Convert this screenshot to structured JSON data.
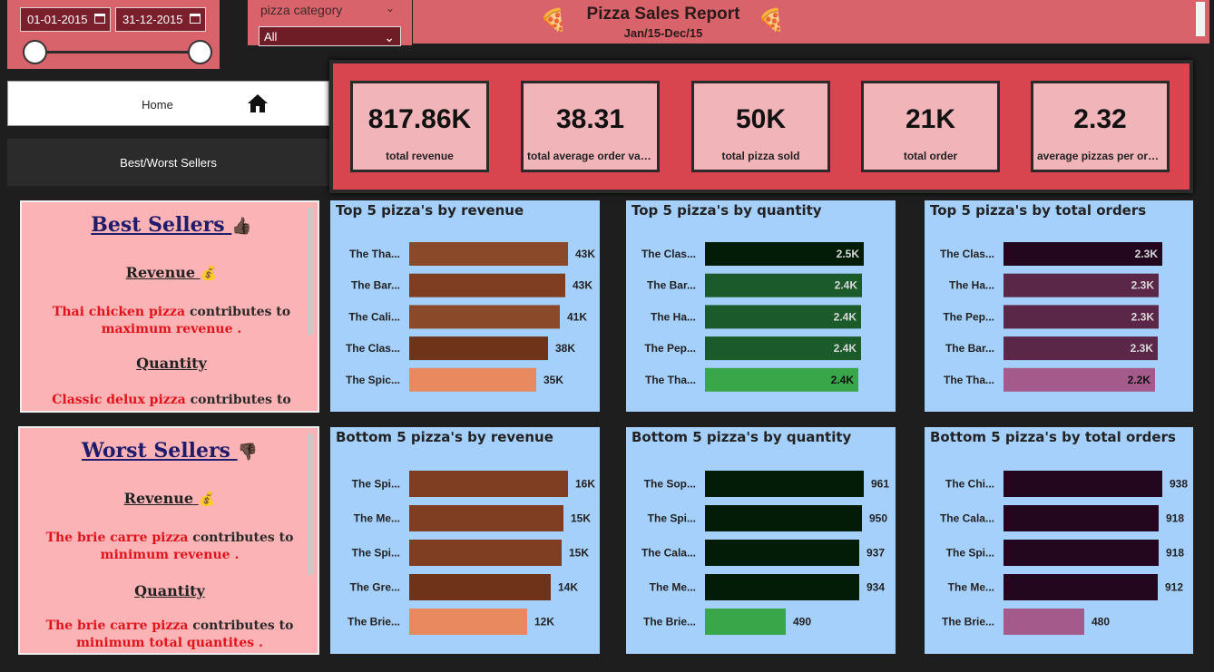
{
  "date_slicer": {
    "start": "01-01-2015",
    "end": "31-12-2015"
  },
  "category_slicer": {
    "label": "pizza category",
    "selected": "All"
  },
  "header": {
    "title": "Pizza Sales Report",
    "subtitle": "Jan/15-Dec/15",
    "icon": "pizza-icon"
  },
  "nav": {
    "home": "Home",
    "best_worst": "Best/Worst Sellers",
    "home_icon": "house-icon"
  },
  "kpis": [
    {
      "value": "817.86K",
      "label": "total revenue"
    },
    {
      "value": "38.31",
      "label": "total average order value"
    },
    {
      "value": "50K",
      "label": "total pizza sold"
    },
    {
      "value": "21K",
      "label": "total order"
    },
    {
      "value": "2.32",
      "label": "average pizzas per order"
    }
  ],
  "best_sellers": {
    "title": "Best Sellers",
    "title_icon": "thumbs-up-icon",
    "revenue_heading": "Revenue",
    "revenue_highlight": "Thai chicken pizza",
    "revenue_text": " contributes to",
    "revenue_line2": "maximum revenue .",
    "quantity_heading": "Quantity",
    "quantity_highlight": "Classic delux pizza",
    "quantity_text": " contributes to"
  },
  "worst_sellers": {
    "title": "Worst Sellers",
    "title_icon": "thumbs-down-icon",
    "revenue_heading": "Revenue",
    "revenue_highlight": "The brie carre pizza",
    "revenue_text": " contributes to",
    "revenue_line2": "minimum revenue .",
    "quantity_heading": "Quantity",
    "quantity_highlight": "The brie carre pizza",
    "quantity_text": "  contributes to",
    "quantity_line2": "minimum total quantites ."
  },
  "chart_data": [
    {
      "type": "bar",
      "orientation": "horizontal",
      "title": "Top 5 pizza's by revenue",
      "categories": [
        "The Tha...",
        "The Bar...",
        "The Cali...",
        "The Clas...",
        "The Spic..."
      ],
      "values": [
        43434,
        42768,
        41410,
        38180,
        34832
      ],
      "labels": [
        "43K",
        "43K",
        "41K",
        "38K",
        "35K"
      ],
      "label_position": "outside",
      "colors": [
        "#8a4a2a",
        "#7f3e22",
        "#8a4a2a",
        "#6f3319",
        "#e8895f"
      ]
    },
    {
      "type": "bar",
      "orientation": "horizontal",
      "title": "Top 5 pizza's by quantity",
      "categories": [
        "The Clas...",
        "The Bar...",
        "The Ha...",
        "The Pep...",
        "The Tha..."
      ],
      "values": [
        2453,
        2432,
        2422,
        2418,
        2371
      ],
      "labels": [
        "2.5K",
        "2.4K",
        "2.4K",
        "2.4K",
        "2.4K"
      ],
      "label_position": "inside",
      "colors": [
        "#021c07",
        "#1b5a2b",
        "#1b5a2b",
        "#1b5a2b",
        "#3aa64a"
      ]
    },
    {
      "type": "bar",
      "orientation": "horizontal",
      "title": "Top 5 pizza's by total orders",
      "categories": [
        "The Clas...",
        "The Ha...",
        "The Pep...",
        "The Bar...",
        "The Tha..."
      ],
      "values": [
        2329,
        2280,
        2278,
        2273,
        2225
      ],
      "labels": [
        "2.3K",
        "2.3K",
        "2.3K",
        "2.3K",
        "2.2K"
      ],
      "label_position": "inside",
      "colors": [
        "#23071e",
        "#5a2748",
        "#5a2748",
        "#5a2748",
        "#a55a8c"
      ]
    },
    {
      "type": "bar",
      "orientation": "horizontal",
      "title": "Bottom 5 pizza's by revenue",
      "categories": [
        "The Spi...",
        "The Me...",
        "The Spi...",
        "The Gre...",
        "The Brie..."
      ],
      "values": [
        15596,
        15235,
        15046,
        13956,
        11588
      ],
      "labels": [
        "16K",
        "15K",
        "15K",
        "14K",
        "12K"
      ],
      "label_position": "outside",
      "colors": [
        "#7f3e22",
        "#7f3e22",
        "#7f3e22",
        "#6f3319",
        "#e8895f"
      ]
    },
    {
      "type": "bar",
      "orientation": "horizontal",
      "title": "Bottom 5 pizza's by quantity",
      "categories": [
        "The Sop...",
        "The Spi...",
        "The Cala...",
        "The Me...",
        "The Brie..."
      ],
      "values": [
        961,
        950,
        937,
        934,
        490
      ],
      "labels": [
        "961",
        "950",
        "937",
        "934",
        "490"
      ],
      "label_position": "outside",
      "colors": [
        "#021c07",
        "#021c07",
        "#021c07",
        "#021c07",
        "#3aa64a"
      ]
    },
    {
      "type": "bar",
      "orientation": "horizontal",
      "title": "Bottom 5 pizza's by total orders",
      "categories": [
        "The Chi...",
        "The Cala...",
        "The Spi...",
        "The Me...",
        "The Brie..."
      ],
      "values": [
        938,
        918,
        918,
        912,
        480
      ],
      "labels": [
        "938",
        "918",
        "918",
        "912",
        "480"
      ],
      "label_position": "outside",
      "colors": [
        "#23071e",
        "#23071e",
        "#23071e",
        "#23071e",
        "#a55a8c"
      ]
    }
  ]
}
